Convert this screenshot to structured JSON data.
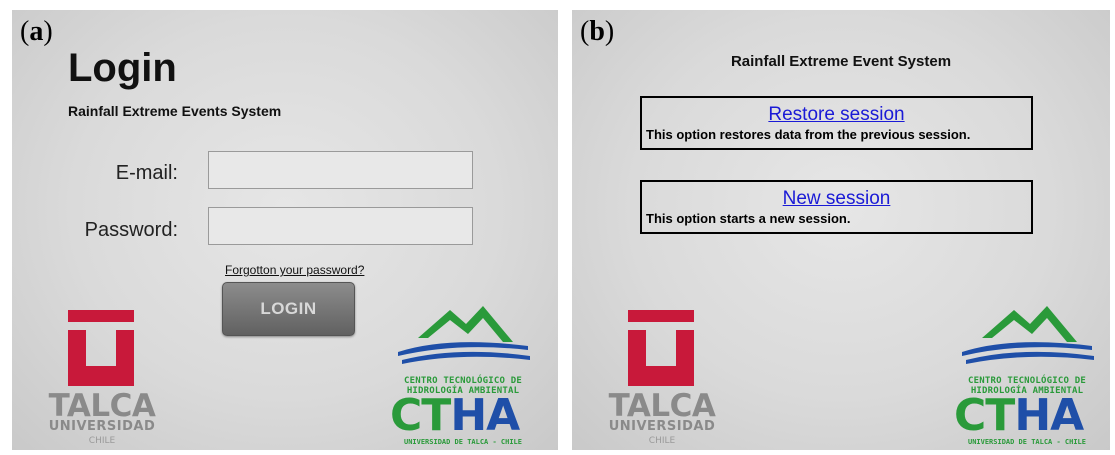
{
  "panel_a": {
    "letter": "a",
    "title": "Login",
    "subtitle": "Rainfall Extreme Events System",
    "email_label": "E-mail:",
    "email_value": "",
    "password_label": "Password:",
    "password_value": "",
    "forgot_link": "Forgotton your password?",
    "login_button": "LOGIN"
  },
  "panel_b": {
    "letter": "b",
    "title": "Rainfall Extreme Event System",
    "options": [
      {
        "link": "Restore session",
        "description": "This option restores data from the previous session."
      },
      {
        "link": "New session",
        "description": "This option starts a new session."
      }
    ]
  },
  "logos": {
    "talca": {
      "name": "TALCA",
      "sub": "UNIVERSIDAD",
      "country": "CHILE",
      "color": "#c8193a"
    },
    "ctha": {
      "line1": "CENTRO TECNOLÓGICO DE",
      "line2": "HIDROLOGÍA AMBIENTAL",
      "big_ct": "CT",
      "big_ha": "HA",
      "univ": "UNIVERSIDAD DE TALCA - CHILE",
      "green": "#2a9a3a",
      "blue": "#1f4fa8"
    }
  }
}
